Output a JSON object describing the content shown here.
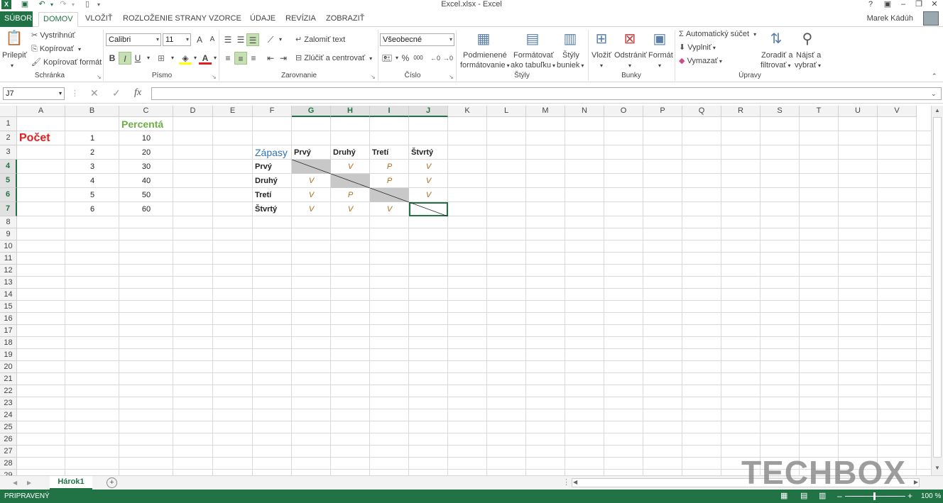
{
  "window": {
    "title": "Excel.xlsx - Excel",
    "user_name": "Marek Kádúh",
    "help_glyph": "?",
    "controls": [
      "▣",
      "–",
      "❐",
      "✕"
    ]
  },
  "tabs": [
    "SÚBOR",
    "DOMOV",
    "VLOŽIŤ",
    "ROZLOŽENIE STRANY",
    "VZORCE",
    "ÚDAJE",
    "REVÍZIA",
    "ZOBRAZIŤ"
  ],
  "ribbon": {
    "clipboard": {
      "paste": "Prilepiť",
      "cut": "Vystrihnúť",
      "copy": "Kopírovať",
      "format_painter": "Kopírovať formát",
      "label": "Schránka"
    },
    "font": {
      "name": "Calibri",
      "size": "11",
      "bold": "B",
      "italic": "I",
      "underline": "U",
      "grow": "A",
      "shrink": "A",
      "font_color": "A",
      "label": "Písmo"
    },
    "alignment": {
      "wrap": "Zalomiť text",
      "merge": "Zlúčiť a centrovať",
      "label": "Zarovnanie"
    },
    "number": {
      "format": "Všeobecné",
      "percent": "%",
      "thousands": "000",
      "label": "Číslo"
    },
    "styles": {
      "conditional": [
        "Podmienené",
        "formátovanie"
      ],
      "as_table": [
        "Formátovať",
        "ako tabuľku"
      ],
      "cell_styles": [
        "Štýly",
        "buniek"
      ],
      "label": "Štýly"
    },
    "cells": {
      "insert": "Vložiť",
      "delete": "Odstrániť",
      "format": "Formát",
      "label": "Bunky"
    },
    "editing": {
      "autosum": "Automatický súčet",
      "fill": "Vyplniť",
      "clear": "Vymazať",
      "sort": [
        "Zoradiť a",
        "filtrovať"
      ],
      "find": [
        "Nájsť a",
        "vybrať"
      ],
      "label": "Úpravy"
    }
  },
  "formula_bar": {
    "name_box": "J7",
    "cancel": "✕",
    "enter": "✓",
    "fx": "fx",
    "value": ""
  },
  "sheet": {
    "columns": [
      "A",
      "B",
      "C",
      "D",
      "E",
      "F",
      "G",
      "H",
      "I",
      "J",
      "K",
      "L",
      "M",
      "N",
      "O",
      "P",
      "Q",
      "R",
      "S",
      "T",
      "U",
      "V"
    ],
    "rows": [
      "1",
      "2",
      "3",
      "4",
      "5",
      "6",
      "7",
      "8",
      "9",
      "10",
      "11",
      "12",
      "13",
      "14",
      "15",
      "16",
      "17",
      "18",
      "19",
      "20",
      "21",
      "22",
      "23",
      "24",
      "25",
      "26",
      "27",
      "28",
      "29"
    ],
    "selected_cell": "J7",
    "pocet_label": "Počet",
    "percenta_label": "Percentá",
    "b_values": [
      "1",
      "2",
      "3",
      "4",
      "5",
      "6"
    ],
    "c_values": [
      "10",
      "20",
      "30",
      "40",
      "50",
      "60"
    ],
    "matches_title": "Zápasy",
    "team_headers": [
      "Prvý",
      "Druhý",
      "Tretí",
      "Štvrtý"
    ],
    "results": [
      [
        "",
        "V",
        "P",
        "V"
      ],
      [
        "V",
        "",
        "P",
        "V"
      ],
      [
        "V",
        "P",
        "",
        "V"
      ],
      [
        "V",
        "V",
        "V",
        ""
      ]
    ]
  },
  "sheet_tabs": [
    "Hárok1"
  ],
  "status": {
    "ready": "PRIPRAVENÝ",
    "zoom": "100 %"
  },
  "watermark": "TECHBOX",
  "colors": {
    "excel_green": "#217346",
    "pocet_red": "#e02020",
    "percenta_green": "#70ad47",
    "zapasy_blue": "#2e75b6",
    "result_orange": "#b06a1a",
    "gray_cell": "#c8c8c8"
  }
}
